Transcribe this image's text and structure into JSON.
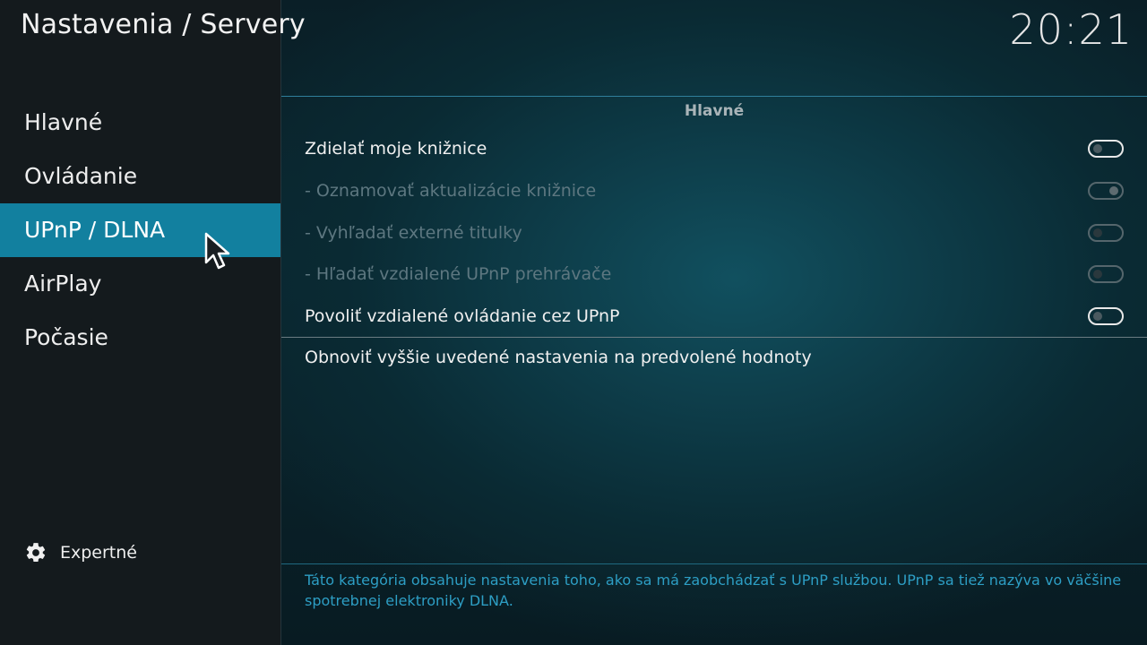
{
  "header": {
    "title": "Nastavenia / Servery",
    "clock": "20:21"
  },
  "sidebar": {
    "items": [
      {
        "label": "Hlavné",
        "active": false
      },
      {
        "label": "Ovládanie",
        "active": false
      },
      {
        "label": "UPnP / DLNA",
        "active": true
      },
      {
        "label": "AirPlay",
        "active": false
      },
      {
        "label": "Počasie",
        "active": false
      }
    ],
    "level": {
      "label": "Expertné",
      "icon": "gear-icon"
    }
  },
  "section": {
    "title": "Hlavné",
    "settings": [
      {
        "label": "Zdielať moje knižnice",
        "enabled": true,
        "value": false
      },
      {
        "label": "- Oznamovať aktualizácie knižnice",
        "enabled": false,
        "value": true
      },
      {
        "label": "- Vyhľadať externé titulky",
        "enabled": false,
        "value": false
      },
      {
        "label": "- Hľadať vzdialené UPnP prehrávače",
        "enabled": false,
        "value": false
      },
      {
        "label": "Povoliť vzdialené ovládanie cez UPnP",
        "enabled": true,
        "value": false
      }
    ],
    "reset_label": "Obnoviť vyššie uvedené nastavenia na predvolené hodnoty"
  },
  "description": "Táto kategória obsahuje nastavenia toho, ako sa má zaobchádzať s UPnP službou. UPnP sa tiež nazýva vo väčšine spotrebnej elektroniky DLNA.",
  "colors": {
    "accent": "#12809f",
    "description_text": "#2d9ec4"
  }
}
